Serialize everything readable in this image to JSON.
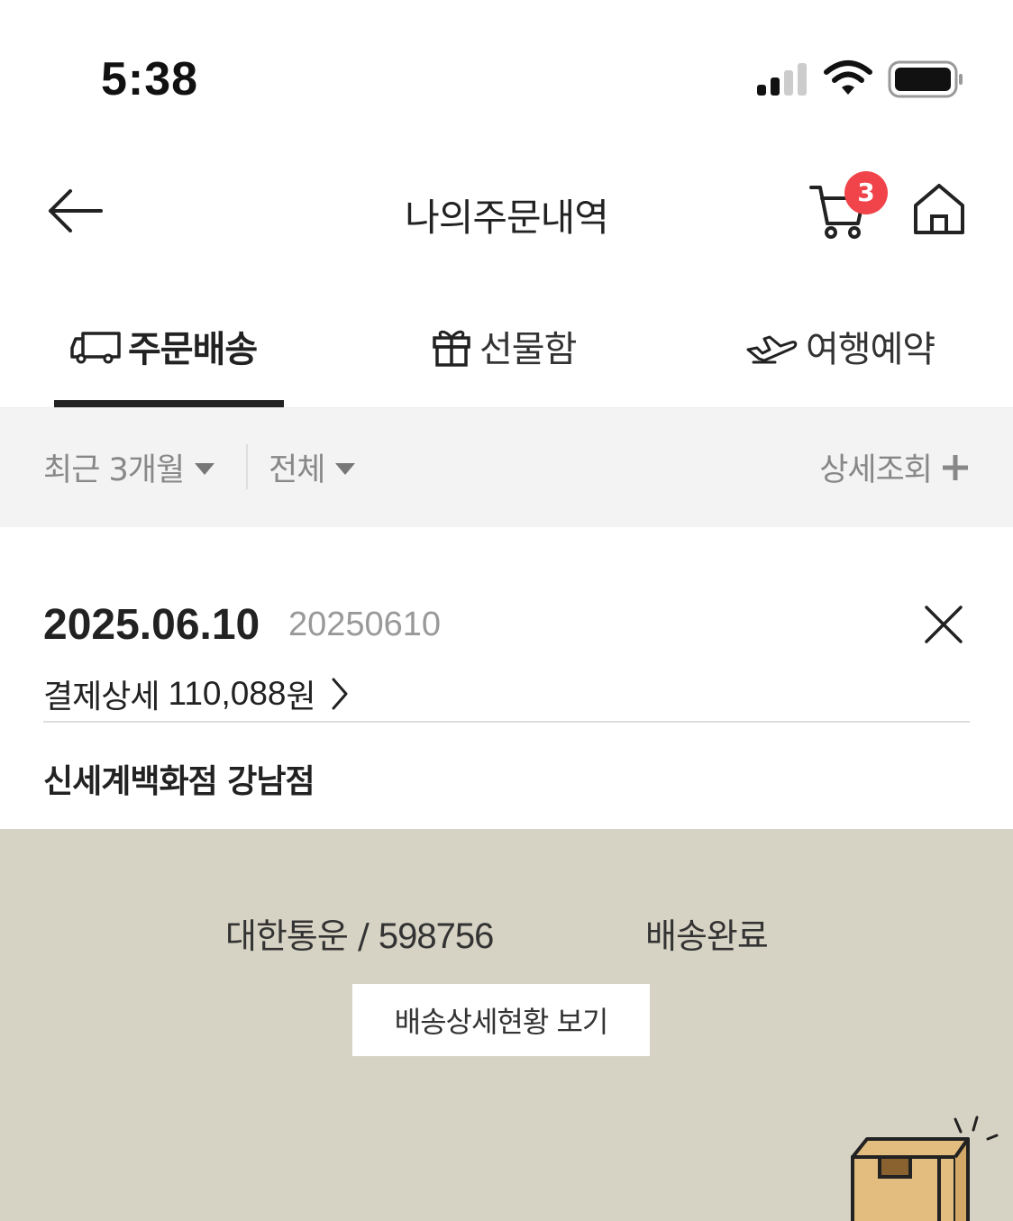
{
  "status_bar": {
    "time": "5:38",
    "icons": [
      "signal-icon",
      "wifi-icon",
      "battery-icon"
    ]
  },
  "header": {
    "title": "나의주문내역",
    "back_icon": "back-arrow-icon",
    "cart_icon": "cart-icon",
    "cart_badge": "3",
    "home_icon": "home-icon"
  },
  "tabs": [
    {
      "label": "주문배송",
      "icon": "truck-icon",
      "active": true
    },
    {
      "label": "선물함",
      "icon": "gift-icon",
      "active": false
    },
    {
      "label": "여행예약",
      "icon": "airplane-icon",
      "active": false
    }
  ],
  "filters": {
    "period": "최근 3개월",
    "type": "전체",
    "detail_search": "상세조회"
  },
  "order": {
    "date": "2025.06.10",
    "order_number": "20250610",
    "payment_label": "결제상세",
    "payment_amount": "110,088",
    "payment_unit": "원",
    "store_name": "신세계백화점 강남점"
  },
  "delivery": {
    "courier": "대한통운",
    "separator": "/",
    "tracking_number": "598756",
    "status": "배송완료",
    "tracking_button": "배송상세현황 보기"
  },
  "colors": {
    "badge": "#f0444a",
    "filter_bg": "#f3f3f3",
    "delivery_bg": "#d7d3c4",
    "box_fill": "#e2bd7f"
  }
}
